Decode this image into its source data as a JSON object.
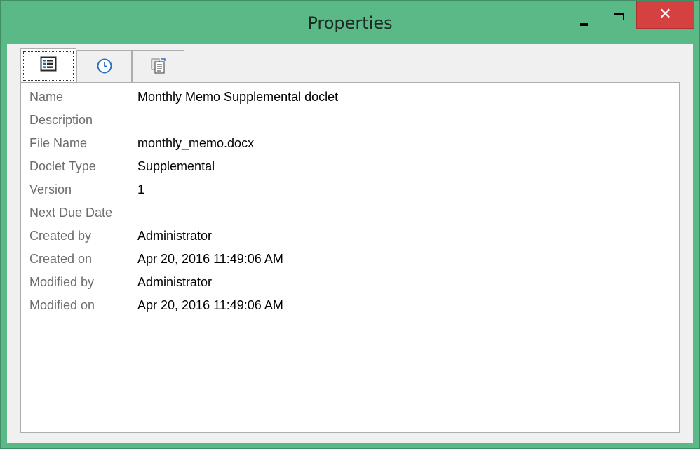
{
  "window": {
    "title": "Properties",
    "controls": {
      "minimize_icon": "minimize-icon",
      "maximize_icon": "maximize-icon",
      "close_glyph": "✕"
    },
    "colors": {
      "frame": "#5ab987",
      "close_button": "#d54040"
    }
  },
  "tabs": [
    {
      "icon": "properties-list-icon",
      "active": true
    },
    {
      "icon": "clock-icon",
      "active": false
    },
    {
      "icon": "document-copy-icon",
      "active": false
    }
  ],
  "properties": [
    {
      "label": "Name",
      "value": "Monthly Memo Supplemental doclet"
    },
    {
      "label": "Description",
      "value": ""
    },
    {
      "label": "File Name",
      "value": "monthly_memo.docx"
    },
    {
      "label": "Doclet Type",
      "value": "Supplemental"
    },
    {
      "label": "Version",
      "value": "1"
    },
    {
      "label": "Next Due Date",
      "value": ""
    },
    {
      "label": "Created by",
      "value": "Administrator"
    },
    {
      "label": "Created on",
      "value": "Apr 20, 2016 11:49:06 AM"
    },
    {
      "label": "Modified by",
      "value": "Administrator"
    },
    {
      "label": "Modified on",
      "value": "Apr 20, 2016 11:49:06 AM"
    }
  ]
}
